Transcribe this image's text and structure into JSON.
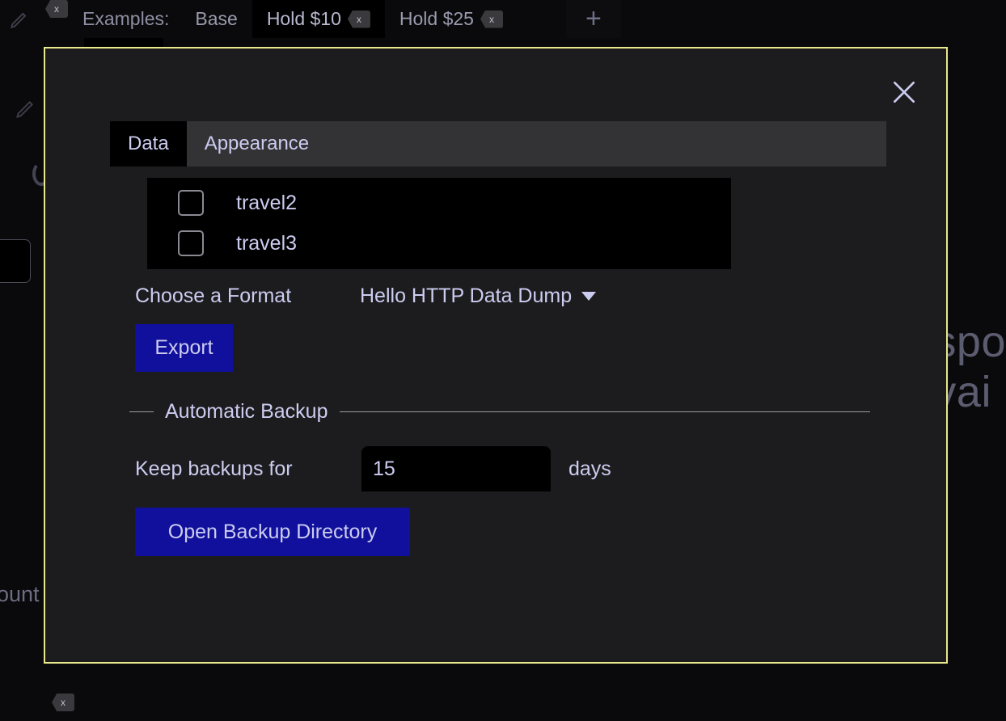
{
  "background": {
    "pencil_icon_top": "pencil-icon",
    "pencil_icon_left": "pencil-icon",
    "tab_badge_label": "x",
    "tabs": [
      {
        "label": "Examples:",
        "selected": false,
        "closable": false
      },
      {
        "label": "Base",
        "selected": false,
        "closable": false
      },
      {
        "label": "Hold $10",
        "selected": true,
        "closable": true
      },
      {
        "label": "Hold $25",
        "selected": false,
        "closable": true
      }
    ],
    "add_tab_label": "+",
    "right_text_line1": "spo",
    "right_text_line2": "vai",
    "left_text": "ount",
    "bottom_badge_label": "x"
  },
  "dialog": {
    "close_label": "Close",
    "border_color": "#e9e98d",
    "background_color": "#1c1c1e",
    "tabs": [
      {
        "label": "Data",
        "active": true
      },
      {
        "label": "Appearance",
        "active": false
      }
    ],
    "data_panel": {
      "checkbox_list": [
        {
          "label": "travel2",
          "checked": false
        },
        {
          "label": "travel3",
          "checked": false
        }
      ],
      "format_label": "Choose a Format",
      "format_selected": "Hello HTTP Data Dump",
      "format_options": [
        "Hello HTTP Data Dump"
      ],
      "export_label": "Export",
      "backup_section_legend": "Automatic Backup",
      "keep_backups_label": "Keep backups for",
      "keep_backups_value": "15",
      "keep_backups_placeholder": "",
      "days_suffix": "days",
      "open_backup_label": "Open Backup Directory",
      "accent_color": "#10109c"
    }
  }
}
